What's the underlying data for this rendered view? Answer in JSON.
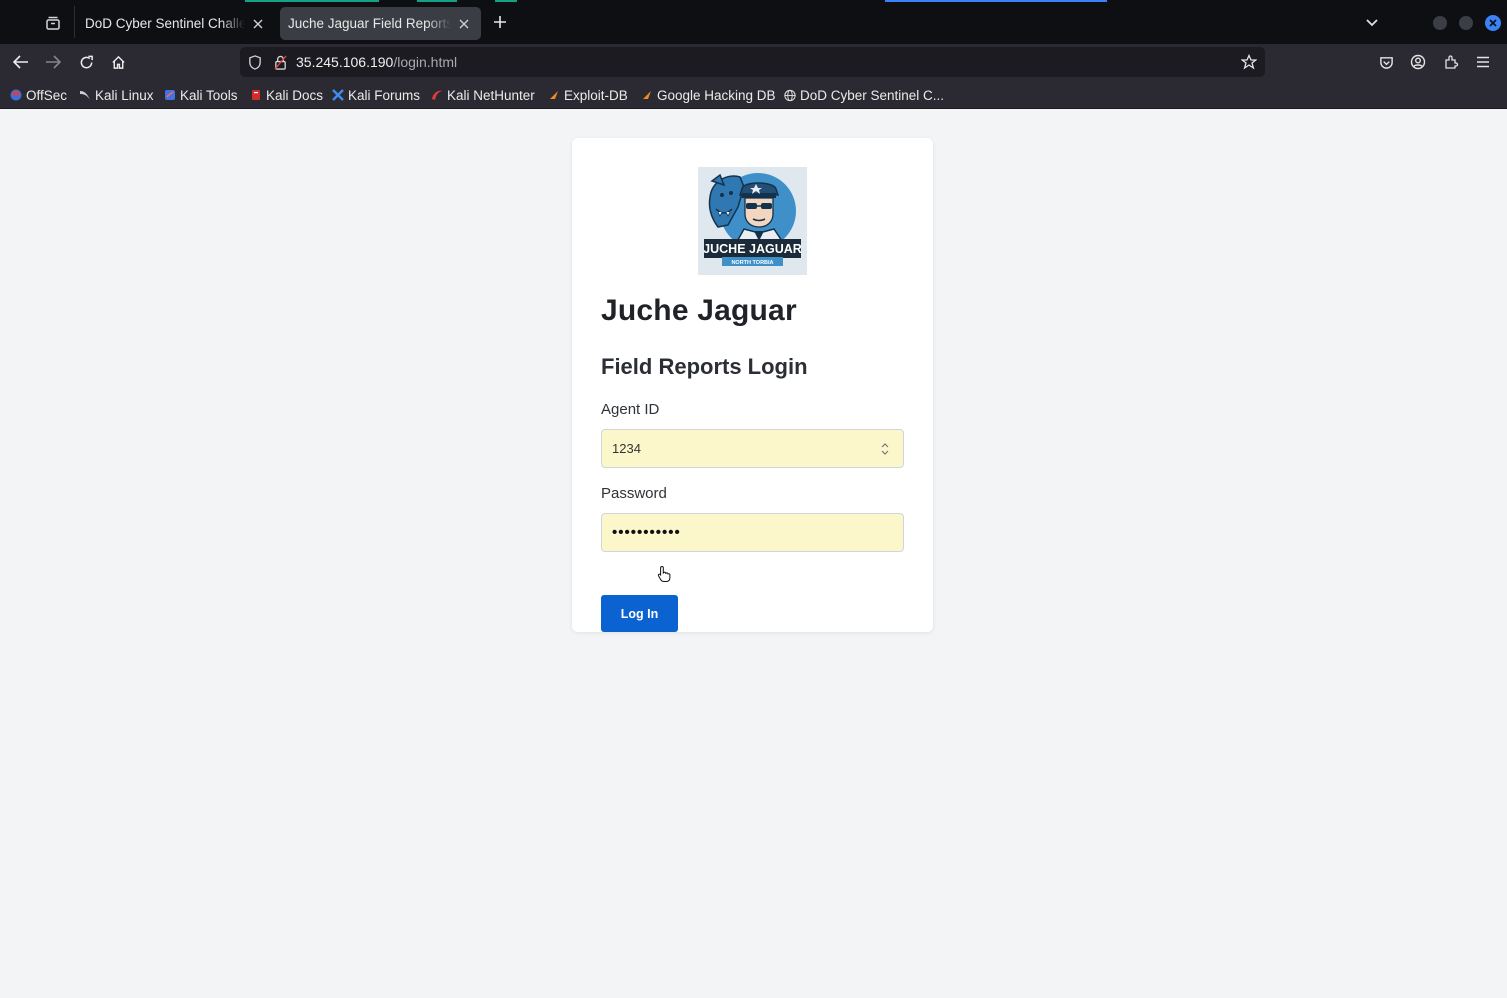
{
  "browser": {
    "tabs": [
      {
        "label": "DoD Cyber Sentinel Challeng",
        "active": false
      },
      {
        "label": "Juche Jaguar Field Reports –",
        "active": true
      }
    ],
    "url_host": "35.245.106.190",
    "url_path": "/login.html",
    "bookmarks": [
      {
        "label": "OffSec",
        "icon": "offsec-icon"
      },
      {
        "label": "Kali Linux",
        "icon": "kali-dragon-icon"
      },
      {
        "label": "Kali Tools",
        "icon": "kali-tools-icon"
      },
      {
        "label": "Kali Docs",
        "icon": "kali-docs-icon"
      },
      {
        "label": "Kali Forums",
        "icon": "kali-forums-icon"
      },
      {
        "label": "Kali NetHunter",
        "icon": "nethunter-icon"
      },
      {
        "label": "Exploit-DB",
        "icon": "exploit-db-icon"
      },
      {
        "label": "Google Hacking DB",
        "icon": "ghdb-icon"
      },
      {
        "label": "DoD Cyber Sentinel C...",
        "icon": "globe-icon"
      }
    ],
    "colors": {
      "tabbar": "#0d0f12",
      "toolbar": "#2b2a33",
      "accent": "#3b82f6"
    }
  },
  "page": {
    "logo": {
      "text_main": "JUCHE JAGUAR",
      "text_sub": "NORTH TORBIA"
    },
    "brand": "Juche Jaguar",
    "form_title": "Field Reports Login",
    "agent_id": {
      "label": "Agent ID",
      "value": "1234"
    },
    "password": {
      "label": "Password",
      "masked": "•••••••••••"
    },
    "login_button": "Log In",
    "colors": {
      "button": "#0b63d1",
      "autofill": "#fcf7cb",
      "background": "#f3f4f6"
    }
  }
}
